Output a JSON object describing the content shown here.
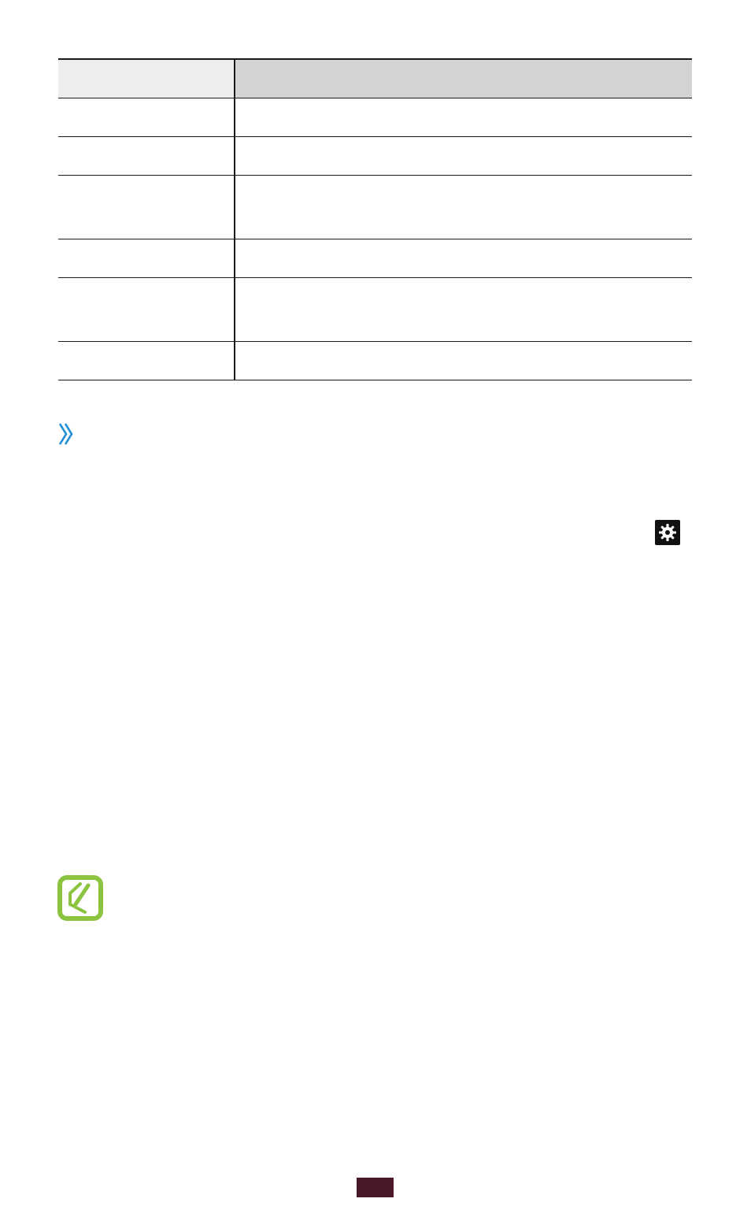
{
  "table": {
    "header": [
      "",
      ""
    ],
    "rows": [
      [
        "",
        ""
      ],
      [
        "",
        ""
      ],
      [
        "",
        ""
      ],
      [
        "",
        ""
      ],
      [
        "",
        ""
      ],
      [
        "",
        ""
      ]
    ]
  },
  "icons": {
    "section_marker": "double-chevron-right-icon",
    "settings": "gear-icon",
    "note": "note-pencil-icon"
  },
  "colors": {
    "section_marker": "#1e8fd6",
    "note_icon": "#8cc43f",
    "page_number_background": "#4a1828",
    "table_header_col1": "#ededed",
    "table_header_col2": "#d3d3d3"
  },
  "page_number": ""
}
